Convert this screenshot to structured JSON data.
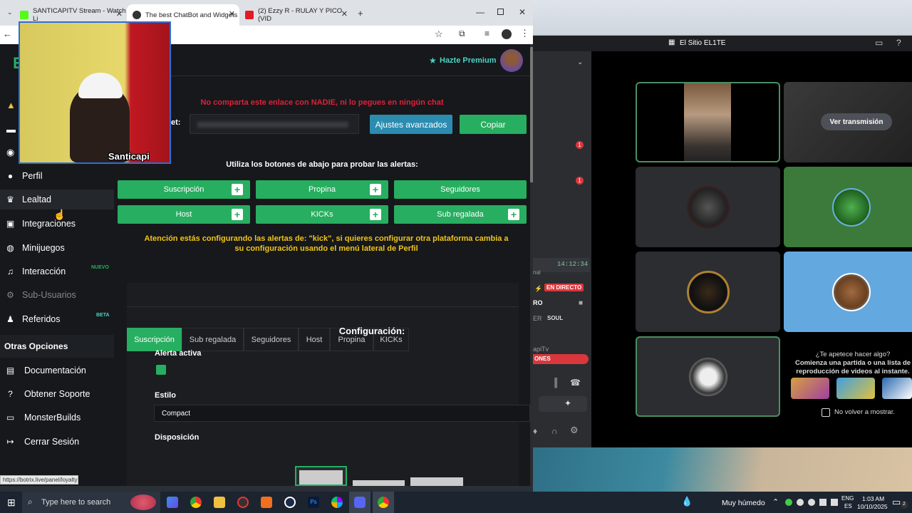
{
  "browser": {
    "tabs": [
      {
        "title": "SANTICAPITV Stream - Watch Li"
      },
      {
        "title": "The best ChatBot and Widgets"
      },
      {
        "title": "(2) Ezzy R - RULAY Y PICO (VID"
      }
    ],
    "status_url": "https://botrix.live/panel/loyalty"
  },
  "header": {
    "premium_label": "Hazte Premium"
  },
  "webcam": {
    "name": "Santicapi"
  },
  "sidebar": {
    "items": [
      {
        "label": "Perfil"
      },
      {
        "label": "Lealtad"
      },
      {
        "label": "Integraciones"
      },
      {
        "label": "Minijuegos"
      },
      {
        "label": "Interacción",
        "badge": "NUEVO"
      },
      {
        "label": "Sub-Usuarios"
      },
      {
        "label": "Referidos",
        "badge": "BETA"
      }
    ],
    "other_heading": "Otras Opciones",
    "other_items": [
      {
        "label": "Documentación"
      },
      {
        "label": "Obtener Soporte"
      },
      {
        "label": "MonsterBuilds"
      },
      {
        "label": "Cerrar Sesión"
      }
    ]
  },
  "main": {
    "warning": "No comparta este enlace con NADIE, ni lo pegues en ningún chat",
    "url_label": "et:",
    "advanced_button": "Ajustes avanzados",
    "copy_button": "Copiar",
    "test_prompt": "Utiliza los botones de abajo para probar las alertas:",
    "alert_buttons": [
      "Suscripción",
      "Propina",
      "Seguidores",
      "Host",
      "KICKs",
      "Sub regalada"
    ],
    "attention": "Atención estás configurando las alertas de: \"kick\", si quieres configurar otra plataforma cambia a su configuración usando el menú lateral de Perfil",
    "tabs": [
      "Suscripción",
      "Sub regalada",
      "Seguidores",
      "Host",
      "Propina",
      "KICKs"
    ],
    "config_title": "Configuración:",
    "active_label": "Alerta activa",
    "style_label": "Estilo",
    "style_value": "Compact",
    "layout_label": "Disposición"
  },
  "discord": {
    "server_title": "El Sitio EL1TE",
    "notif_badge": "1",
    "time": "14:12:34",
    "live_badge": "EN DIRECTO",
    "channel_fragment": "nal",
    "ro_fragment": "RO",
    "soul_label": "SOUL",
    "er_fragment": "ER",
    "user_fragment": "apiTv",
    "ones_fragment": "ONES",
    "watch_button": "Ver transmisión",
    "activity_title": "¿Te apetece hacer algo?",
    "activity_text": "Comienza una partida o una lista de reproducción de videos al instante.",
    "dont_show": "No volver a mostrar."
  },
  "taskbar": {
    "search_placeholder": "Type here to search",
    "weather": "Muy húmedo",
    "lang1": "ENG",
    "lang2": "ES",
    "time": "1:03 AM",
    "date": "10/10/2025",
    "notif_count": "2"
  }
}
